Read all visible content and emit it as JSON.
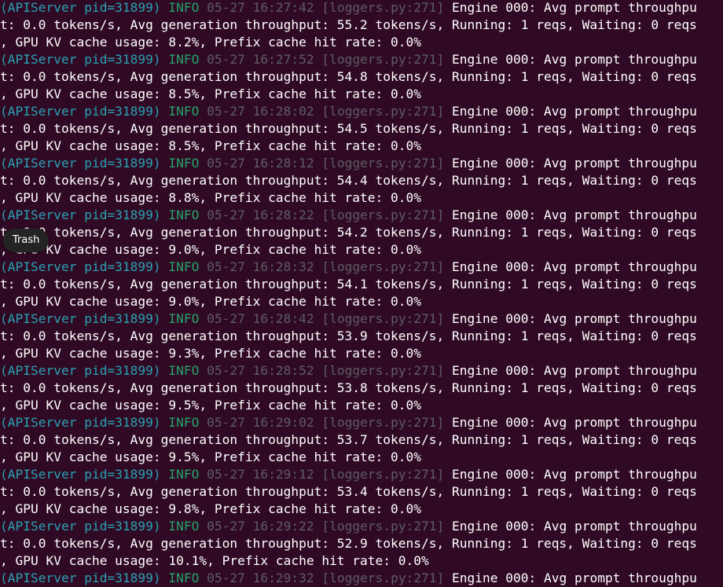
{
  "terminal": {
    "entries": [
      {
        "source": "(APIServer pid=31899)",
        "level": "INFO",
        "timestamp": "05-27 16:27:42",
        "location": "[loggers.py:271]",
        "line1": "Engine 000: Avg prompt throughpu",
        "line2": "t: 0.0 tokens/s, Avg generation throughput: 55.2 tokens/s, Running: 1 reqs, Waiting: 0 reqs",
        "line3": ", GPU KV cache usage: 8.2%, Prefix cache hit rate: 0.0%"
      },
      {
        "source": "(APIServer pid=31899)",
        "level": "INFO",
        "timestamp": "05-27 16:27:52",
        "location": "[loggers.py:271]",
        "line1": "Engine 000: Avg prompt throughpu",
        "line2": "t: 0.0 tokens/s, Avg generation throughput: 54.8 tokens/s, Running: 1 reqs, Waiting: 0 reqs",
        "line3": ", GPU KV cache usage: 8.5%, Prefix cache hit rate: 0.0%"
      },
      {
        "source": "(APIServer pid=31899)",
        "level": "INFO",
        "timestamp": "05-27 16:28:02",
        "location": "[loggers.py:271]",
        "line1": "Engine 000: Avg prompt throughpu",
        "line2": "t: 0.0 tokens/s, Avg generation throughput: 54.5 tokens/s, Running: 1 reqs, Waiting: 0 reqs",
        "line3": ", GPU KV cache usage: 8.5%, Prefix cache hit rate: 0.0%"
      },
      {
        "source": "(APIServer pid=31899)",
        "level": "INFO",
        "timestamp": "05-27 16:28:12",
        "location": "[loggers.py:271]",
        "line1": "Engine 000: Avg prompt throughpu",
        "line2": "t: 0.0 tokens/s, Avg generation throughput: 54.4 tokens/s, Running: 1 reqs, Waiting: 0 reqs",
        "line3": ", GPU KV cache usage: 8.8%, Prefix cache hit rate: 0.0%"
      },
      {
        "source": "(APIServer pid=31899)",
        "level": "INFO",
        "timestamp": "05-27 16:28:22",
        "location": "[loggers.py:271]",
        "line1": "Engine 000: Avg prompt throughpu",
        "line2": "t: 0.0 tokens/s, Avg generation throughput: 54.2 tokens/s, Running: 1 reqs, Waiting: 0 reqs",
        "line3": ", GPU KV cache usage: 9.0%, Prefix cache hit rate: 0.0%"
      },
      {
        "source": "(APIServer pid=31899)",
        "level": "INFO",
        "timestamp": "05-27 16:28:32",
        "location": "[loggers.py:271]",
        "line1": "Engine 000: Avg prompt throughpu",
        "line2": "t: 0.0 tokens/s, Avg generation throughput: 54.1 tokens/s, Running: 1 reqs, Waiting: 0 reqs",
        "line3": ", GPU KV cache usage: 9.0%, Prefix cache hit rate: 0.0%"
      },
      {
        "source": "(APIServer pid=31899)",
        "level": "INFO",
        "timestamp": "05-27 16:28:42",
        "location": "[loggers.py:271]",
        "line1": "Engine 000: Avg prompt throughpu",
        "line2": "t: 0.0 tokens/s, Avg generation throughput: 53.9 tokens/s, Running: 1 reqs, Waiting: 0 reqs",
        "line3": ", GPU KV cache usage: 9.3%, Prefix cache hit rate: 0.0%"
      },
      {
        "source": "(APIServer pid=31899)",
        "level": "INFO",
        "timestamp": "05-27 16:28:52",
        "location": "[loggers.py:271]",
        "line1": "Engine 000: Avg prompt throughpu",
        "line2": "t: 0.0 tokens/s, Avg generation throughput: 53.8 tokens/s, Running: 1 reqs, Waiting: 0 reqs",
        "line3": ", GPU KV cache usage: 9.5%, Prefix cache hit rate: 0.0%"
      },
      {
        "source": "(APIServer pid=31899)",
        "level": "INFO",
        "timestamp": "05-27 16:29:02",
        "location": "[loggers.py:271]",
        "line1": "Engine 000: Avg prompt throughpu",
        "line2": "t: 0.0 tokens/s, Avg generation throughput: 53.7 tokens/s, Running: 1 reqs, Waiting: 0 reqs",
        "line3": ", GPU KV cache usage: 9.5%, Prefix cache hit rate: 0.0%"
      },
      {
        "source": "(APIServer pid=31899)",
        "level": "INFO",
        "timestamp": "05-27 16:29:12",
        "location": "[loggers.py:271]",
        "line1": "Engine 000: Avg prompt throughpu",
        "line2": "t: 0.0 tokens/s, Avg generation throughput: 53.4 tokens/s, Running: 1 reqs, Waiting: 0 reqs",
        "line3": ", GPU KV cache usage: 9.8%, Prefix cache hit rate: 0.0%"
      },
      {
        "source": "(APIServer pid=31899)",
        "level": "INFO",
        "timestamp": "05-27 16:29:22",
        "location": "[loggers.py:271]",
        "line1": "Engine 000: Avg prompt throughpu",
        "line2": "t: 0.0 tokens/s, Avg generation throughput: 52.9 tokens/s, Running: 1 reqs, Waiting: 0 reqs",
        "line3": ", GPU KV cache usage: 10.1%, Prefix cache hit rate: 0.0%"
      },
      {
        "source": "(APIServer pid=31899)",
        "level": "INFO",
        "timestamp": "05-27 16:29:32",
        "location": "[loggers.py:271]",
        "line1": "Engine 000: Avg prompt throughpu",
        "line2": "",
        "line3": ""
      }
    ]
  },
  "tooltip": {
    "label": "Trash"
  },
  "colors": {
    "background": "#300a24",
    "source": "#2aa1b3",
    "level": "#26a269",
    "muted": "#5e5c64",
    "text": "#ffffff"
  }
}
